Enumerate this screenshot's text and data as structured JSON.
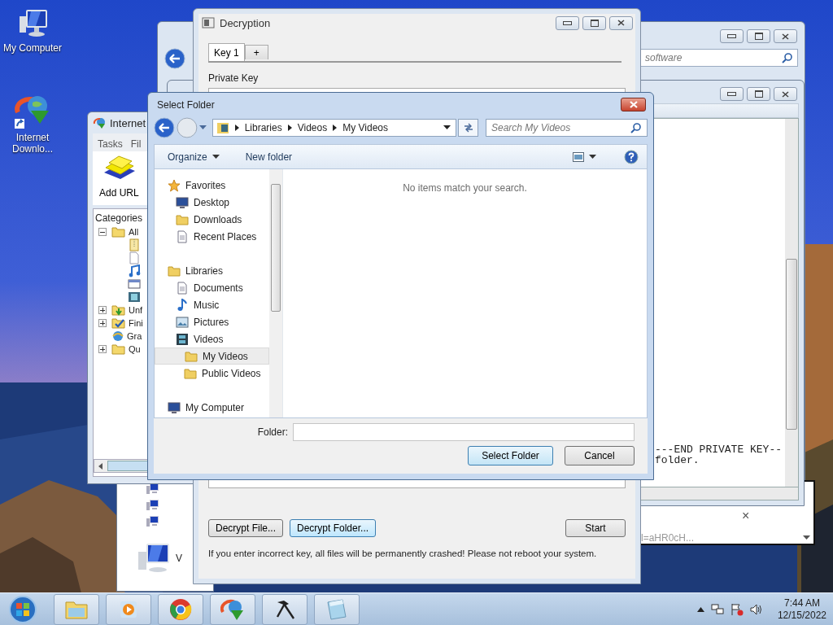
{
  "desktop_icons": [
    {
      "label": "My Computer",
      "kind": "computer"
    },
    {
      "label": "Internet Downlo...",
      "kind": "downloader"
    }
  ],
  "explorer_window": {
    "search": {
      "placeholder": "software"
    }
  },
  "text_window": {
    "lines": [
      "---END PRIVATE KEY--",
      "folder."
    ]
  },
  "browser_window": {
    "close": "×",
    "text": "l=aHR0cH..."
  },
  "computer_window": {
    "label": "V"
  },
  "idm_window": {
    "title": "Internet",
    "menu": [
      "Tasks",
      "Fil"
    ],
    "add_url": "Add URL",
    "categories_label": "Categories",
    "tree": [
      {
        "label": "All",
        "kind": "folder-open",
        "expanded": true,
        "children": [
          {
            "kind": "archive"
          },
          {
            "kind": "document"
          },
          {
            "kind": "music"
          },
          {
            "kind": "program"
          },
          {
            "kind": "video"
          }
        ]
      },
      {
        "label": "Unf",
        "kind": "folder-down",
        "expanded": false
      },
      {
        "label": "Fini",
        "kind": "folder-check",
        "expanded": false
      },
      {
        "label": "Gra",
        "kind": "globe"
      },
      {
        "label": "Qu",
        "kind": "folders",
        "expanded": false
      }
    ]
  },
  "decryption_window": {
    "title": "Decryption",
    "tabs": [
      {
        "label": "Key 1",
        "selected": true
      },
      {
        "label": "+",
        "selected": false
      }
    ],
    "private_key_label": "Private Key",
    "buttons": [
      {
        "label": "Decrypt File...",
        "hover": false
      },
      {
        "label": "Decrypt Folder...",
        "hover": true
      }
    ],
    "start_button": "Start",
    "warning": "If you enter incorrect key, all files will be permanently crashed! Please not reboot your system."
  },
  "select_folder_dialog": {
    "title": "Select Folder",
    "breadcrumb": [
      "Libraries",
      "Videos",
      "My Videos"
    ],
    "search": {
      "placeholder": "Search My Videos"
    },
    "toolbar": {
      "organize": "Organize",
      "new_folder": "New folder"
    },
    "nav": [
      {
        "label": "Favorites",
        "kind": "star",
        "selected": false,
        "children": [
          {
            "label": "Desktop",
            "kind": "monitor",
            "selected": false
          },
          {
            "label": "Downloads",
            "kind": "folder",
            "selected": false
          },
          {
            "label": "Recent Places",
            "kind": "document",
            "selected": false
          }
        ]
      },
      {
        "label": "Libraries",
        "kind": "folder",
        "selected": false,
        "children": [
          {
            "label": "Documents",
            "kind": "document",
            "selected": false
          },
          {
            "label": "Music",
            "kind": "music",
            "selected": false
          },
          {
            "label": "Pictures",
            "kind": "picture",
            "selected": false
          },
          {
            "label": "Videos",
            "kind": "film",
            "selected": false,
            "children": [
              {
                "label": "My Videos",
                "kind": "folder",
                "selected": true
              },
              {
                "label": "Public Videos",
                "kind": "folder",
                "selected": false
              }
            ]
          }
        ]
      },
      {
        "label": "My Computer",
        "kind": "monitor",
        "selected": false
      }
    ],
    "empty_message": "No items match your search.",
    "folder_label": "Folder:",
    "buttons": [
      {
        "label": "Select Folder",
        "default": true
      },
      {
        "label": "Cancel",
        "default": false
      }
    ]
  },
  "taskbar": {
    "apps": [
      {
        "kind": "explorer"
      },
      {
        "kind": "media"
      },
      {
        "kind": "browser"
      },
      {
        "kind": "downloader"
      },
      {
        "kind": "hammer"
      },
      {
        "kind": "notepad"
      }
    ],
    "tray": [
      {
        "kind": "arrow"
      },
      {
        "kind": "network"
      },
      {
        "kind": "flag"
      },
      {
        "kind": "volume"
      }
    ],
    "clock": {
      "time": "7:44 AM",
      "date": "12/15/2022"
    }
  }
}
